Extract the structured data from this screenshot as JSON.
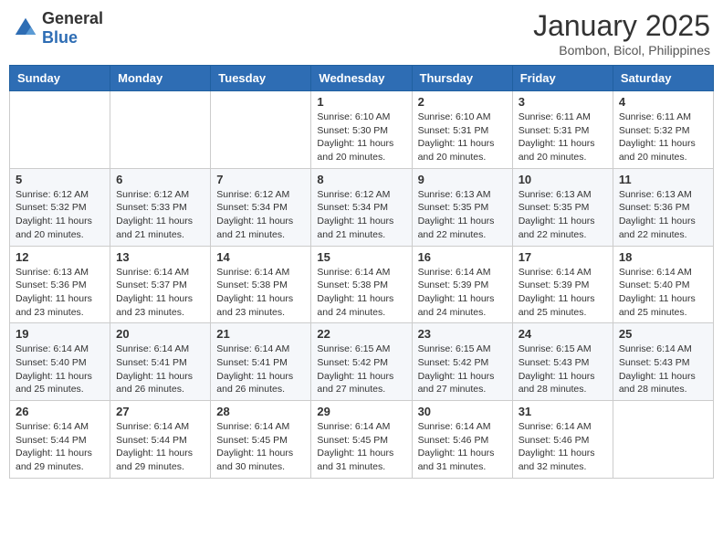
{
  "logo": {
    "general": "General",
    "blue": "Blue"
  },
  "header": {
    "month": "January 2025",
    "location": "Bombon, Bicol, Philippines"
  },
  "weekdays": [
    "Sunday",
    "Monday",
    "Tuesday",
    "Wednesday",
    "Thursday",
    "Friday",
    "Saturday"
  ],
  "weeks": [
    [
      {
        "day": "",
        "info": ""
      },
      {
        "day": "",
        "info": ""
      },
      {
        "day": "",
        "info": ""
      },
      {
        "day": "1",
        "info": "Sunrise: 6:10 AM\nSunset: 5:30 PM\nDaylight: 11 hours and 20 minutes."
      },
      {
        "day": "2",
        "info": "Sunrise: 6:10 AM\nSunset: 5:31 PM\nDaylight: 11 hours and 20 minutes."
      },
      {
        "day": "3",
        "info": "Sunrise: 6:11 AM\nSunset: 5:31 PM\nDaylight: 11 hours and 20 minutes."
      },
      {
        "day": "4",
        "info": "Sunrise: 6:11 AM\nSunset: 5:32 PM\nDaylight: 11 hours and 20 minutes."
      }
    ],
    [
      {
        "day": "5",
        "info": "Sunrise: 6:12 AM\nSunset: 5:32 PM\nDaylight: 11 hours and 20 minutes."
      },
      {
        "day": "6",
        "info": "Sunrise: 6:12 AM\nSunset: 5:33 PM\nDaylight: 11 hours and 21 minutes."
      },
      {
        "day": "7",
        "info": "Sunrise: 6:12 AM\nSunset: 5:34 PM\nDaylight: 11 hours and 21 minutes."
      },
      {
        "day": "8",
        "info": "Sunrise: 6:12 AM\nSunset: 5:34 PM\nDaylight: 11 hours and 21 minutes."
      },
      {
        "day": "9",
        "info": "Sunrise: 6:13 AM\nSunset: 5:35 PM\nDaylight: 11 hours and 22 minutes."
      },
      {
        "day": "10",
        "info": "Sunrise: 6:13 AM\nSunset: 5:35 PM\nDaylight: 11 hours and 22 minutes."
      },
      {
        "day": "11",
        "info": "Sunrise: 6:13 AM\nSunset: 5:36 PM\nDaylight: 11 hours and 22 minutes."
      }
    ],
    [
      {
        "day": "12",
        "info": "Sunrise: 6:13 AM\nSunset: 5:36 PM\nDaylight: 11 hours and 23 minutes."
      },
      {
        "day": "13",
        "info": "Sunrise: 6:14 AM\nSunset: 5:37 PM\nDaylight: 11 hours and 23 minutes."
      },
      {
        "day": "14",
        "info": "Sunrise: 6:14 AM\nSunset: 5:38 PM\nDaylight: 11 hours and 23 minutes."
      },
      {
        "day": "15",
        "info": "Sunrise: 6:14 AM\nSunset: 5:38 PM\nDaylight: 11 hours and 24 minutes."
      },
      {
        "day": "16",
        "info": "Sunrise: 6:14 AM\nSunset: 5:39 PM\nDaylight: 11 hours and 24 minutes."
      },
      {
        "day": "17",
        "info": "Sunrise: 6:14 AM\nSunset: 5:39 PM\nDaylight: 11 hours and 25 minutes."
      },
      {
        "day": "18",
        "info": "Sunrise: 6:14 AM\nSunset: 5:40 PM\nDaylight: 11 hours and 25 minutes."
      }
    ],
    [
      {
        "day": "19",
        "info": "Sunrise: 6:14 AM\nSunset: 5:40 PM\nDaylight: 11 hours and 25 minutes."
      },
      {
        "day": "20",
        "info": "Sunrise: 6:14 AM\nSunset: 5:41 PM\nDaylight: 11 hours and 26 minutes."
      },
      {
        "day": "21",
        "info": "Sunrise: 6:14 AM\nSunset: 5:41 PM\nDaylight: 11 hours and 26 minutes."
      },
      {
        "day": "22",
        "info": "Sunrise: 6:15 AM\nSunset: 5:42 PM\nDaylight: 11 hours and 27 minutes."
      },
      {
        "day": "23",
        "info": "Sunrise: 6:15 AM\nSunset: 5:42 PM\nDaylight: 11 hours and 27 minutes."
      },
      {
        "day": "24",
        "info": "Sunrise: 6:15 AM\nSunset: 5:43 PM\nDaylight: 11 hours and 28 minutes."
      },
      {
        "day": "25",
        "info": "Sunrise: 6:14 AM\nSunset: 5:43 PM\nDaylight: 11 hours and 28 minutes."
      }
    ],
    [
      {
        "day": "26",
        "info": "Sunrise: 6:14 AM\nSunset: 5:44 PM\nDaylight: 11 hours and 29 minutes."
      },
      {
        "day": "27",
        "info": "Sunrise: 6:14 AM\nSunset: 5:44 PM\nDaylight: 11 hours and 29 minutes."
      },
      {
        "day": "28",
        "info": "Sunrise: 6:14 AM\nSunset: 5:45 PM\nDaylight: 11 hours and 30 minutes."
      },
      {
        "day": "29",
        "info": "Sunrise: 6:14 AM\nSunset: 5:45 PM\nDaylight: 11 hours and 31 minutes."
      },
      {
        "day": "30",
        "info": "Sunrise: 6:14 AM\nSunset: 5:46 PM\nDaylight: 11 hours and 31 minutes."
      },
      {
        "day": "31",
        "info": "Sunrise: 6:14 AM\nSunset: 5:46 PM\nDaylight: 11 hours and 32 minutes."
      },
      {
        "day": "",
        "info": ""
      }
    ]
  ]
}
